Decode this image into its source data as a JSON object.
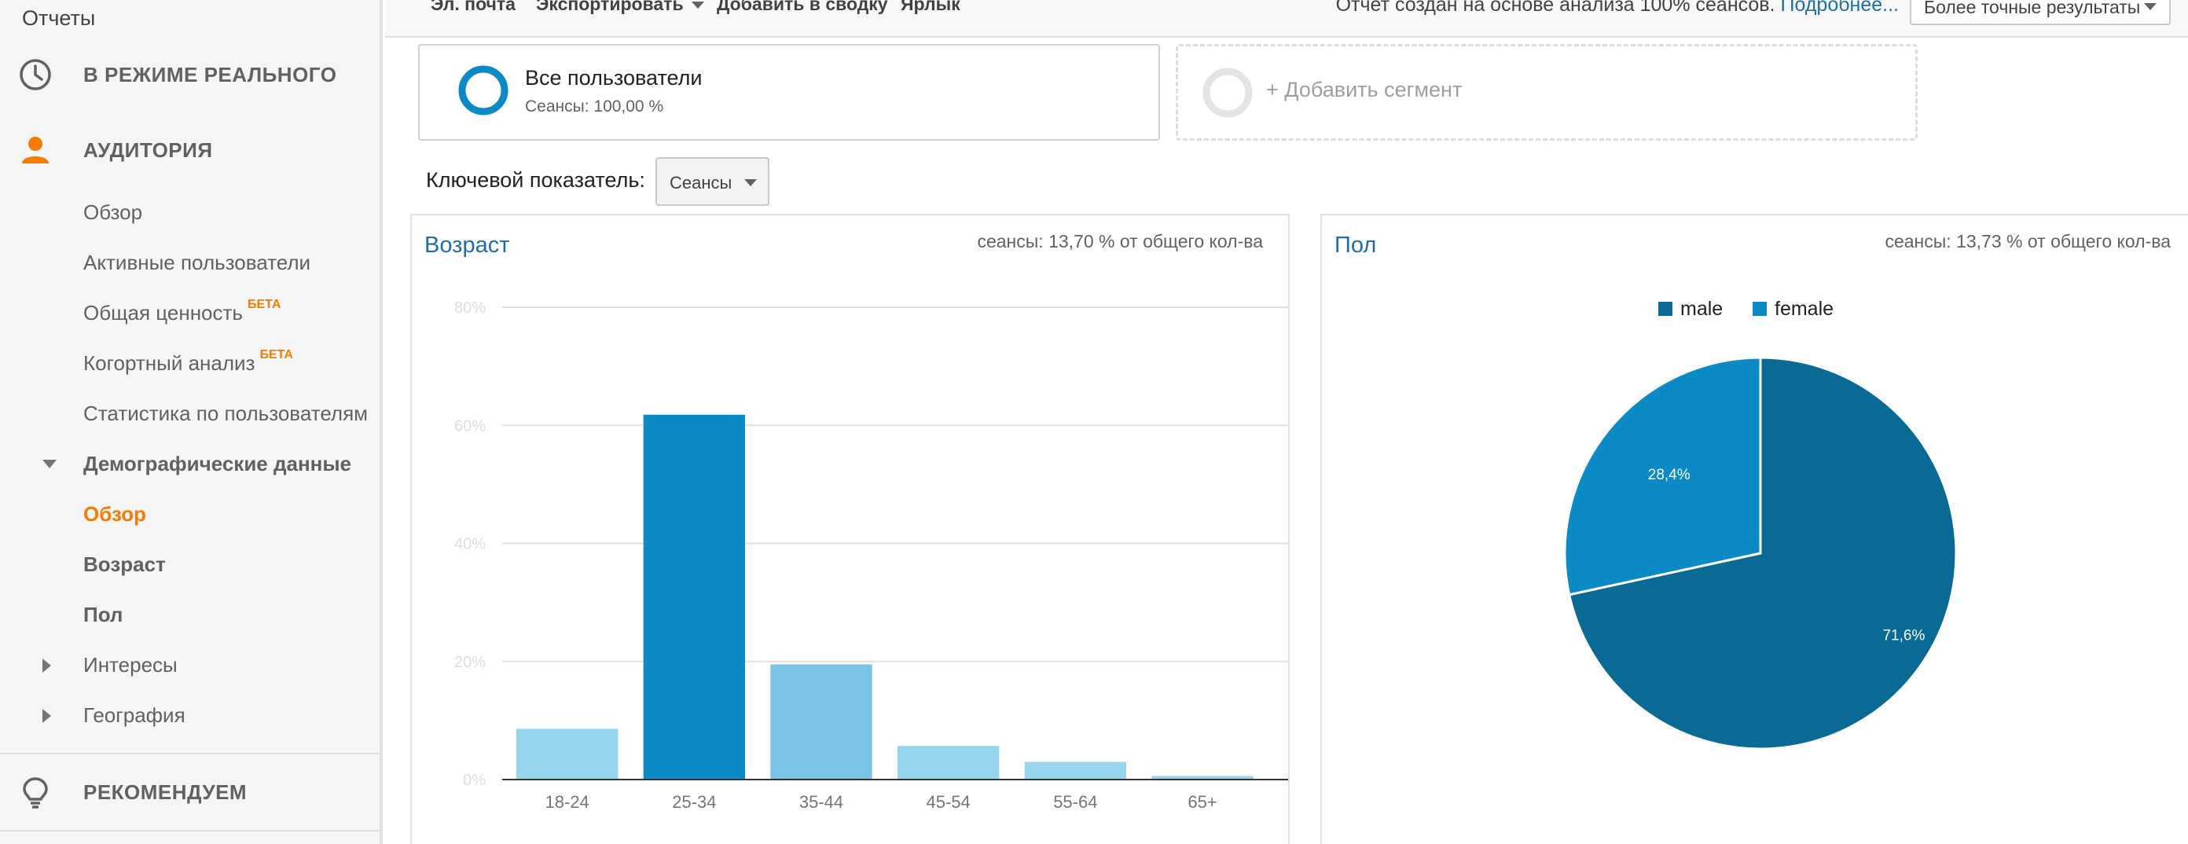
{
  "sidebar": {
    "reports_label": "Отчеты",
    "realtime_label": "В РЕЖИМЕ РЕАЛЬНОГО",
    "audience_label": "АУДИТОРИЯ",
    "audience_items": {
      "overview": "Обзор",
      "active_users": "Активные пользователи",
      "lifetime_value": "Общая ценность",
      "cohort": "Когортный анализ",
      "user_explorer": "Статистика по пользователям",
      "demographics": "Демографические данные",
      "demo_overview": "Обзор",
      "demo_age": "Возраст",
      "demo_gender": "Пол",
      "interests": "Интересы",
      "geo": "География"
    },
    "beta_badge": "БЕТА",
    "recommend_label": "РЕКОМЕНДУЕМ",
    "accent_color": "#f57c00"
  },
  "toolbar": {
    "email": "Эл. почта",
    "export": "Экспортировать",
    "add_dashboard": "Добавить в сводку",
    "shortcut": "Ярлык",
    "sampling_note": "Отчет создан на основе анализа 100% сеансов.",
    "more_link": "Подробнее...",
    "precision_option": "Более точные результаты"
  },
  "segments": {
    "all_users_title": "Все пользователи",
    "all_users_sub": "Сеансы: 100,00 %",
    "add_segment": "+ Добавить сегмент"
  },
  "key_metric": {
    "label": "Ключевой показатель:",
    "value": "Сеансы"
  },
  "age_panel": {
    "title": "Возраст",
    "note": "сеансы: 13,70 % от общего кол-ва"
  },
  "gender_panel": {
    "title": "Пол",
    "note": "сеансы: 13,73 % от общего кол-ва"
  },
  "chart_data": [
    {
      "type": "bar",
      "categories": [
        "18-24",
        "25-34",
        "35-44",
        "45-54",
        "55-64",
        "65+"
      ],
      "values": [
        8.6,
        61.8,
        19.5,
        5.7,
        3.0,
        0.6
      ],
      "ytick_labels": [
        "0%",
        "20%",
        "40%",
        "60%",
        "80%"
      ],
      "ylim": [
        0,
        80
      ],
      "highlight_index": 1,
      "colors": {
        "normal": "#97d4ee",
        "third": "#78c4e6",
        "highlight": "#0b8ac6",
        "grid": "#e0e0e0",
        "axis": "#333333"
      }
    },
    {
      "type": "pie",
      "legend": [
        "male",
        "female"
      ],
      "values": [
        71.6,
        28.4
      ],
      "labels": [
        "71,6%",
        "28,4%"
      ],
      "colors": [
        "#0a6a96",
        "#0b8ac6"
      ],
      "legend_position": "top"
    }
  ]
}
